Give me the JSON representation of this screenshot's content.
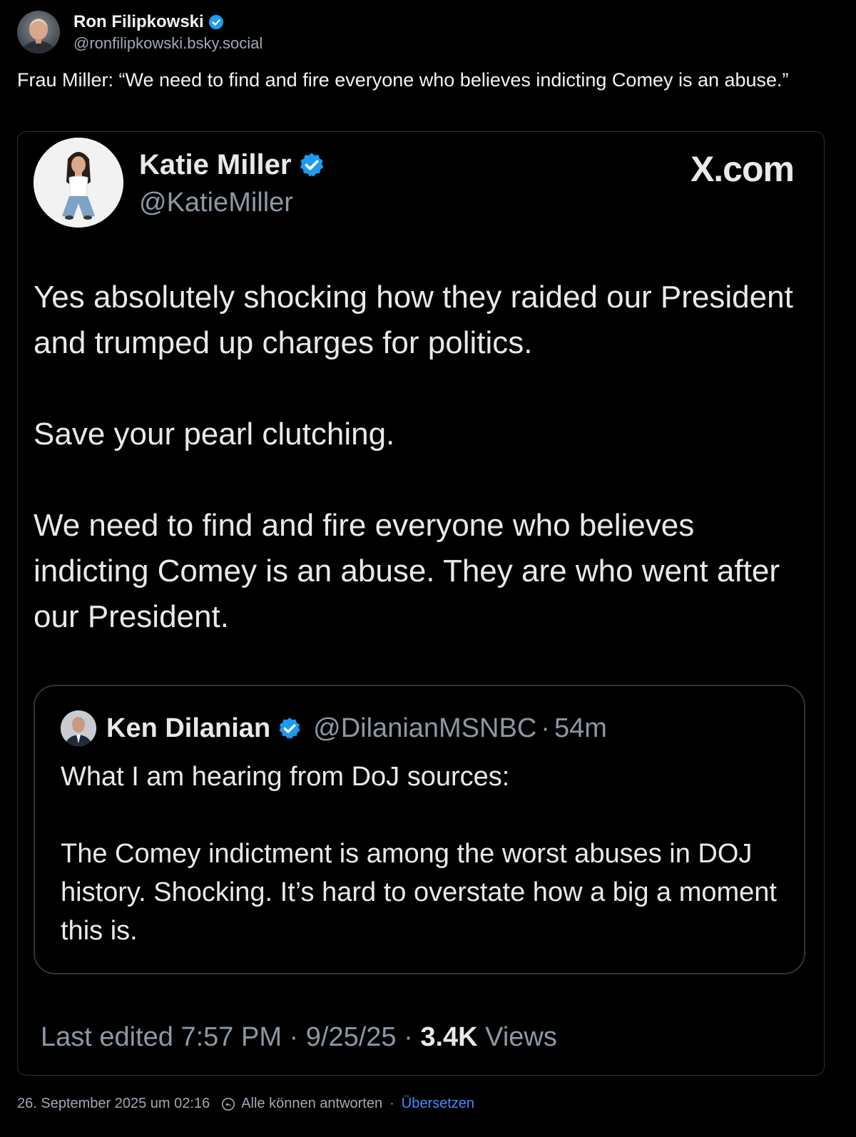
{
  "post": {
    "author": {
      "name": "Ron Filipkowski",
      "handle": "@ronfilipkowski.bsky.social",
      "verified": true
    },
    "text": "Frau Miller: “We need to find and fire everyone who believes indicting Comey is an abuse.”",
    "embedded_screenshot": {
      "brand": "X.com",
      "author": {
        "name": "Katie Miller",
        "handle": "@KatieMiller",
        "verified": true
      },
      "paragraphs": [
        "Yes absolutely shocking how they raided our President and trumped up charges for politics.",
        "Save your pearl clutching.",
        "We need to find and fire everyone who believes indicting Comey is an abuse. They are who went after our President."
      ],
      "quote": {
        "author_name": "Ken Dilanian",
        "handle": "@DilanianMSNBC",
        "separator": "·",
        "time": "54m",
        "paragraphs": [
          "What I am hearing from DoJ sources:",
          "The Comey indictment is among the worst abuses in DOJ history.  Shocking. It’s hard to overstate how a big a moment this is."
        ]
      },
      "meta": {
        "edited": "Last edited 7:57 PM · 9/25/25",
        "separator": " · ",
        "views_count": "3.4K",
        "views_label": " Views"
      }
    },
    "footer": {
      "timestamp": "26. September 2025 um 02:16",
      "reply_setting": "Alle können antworten",
      "separator": "·",
      "translate": "Übersetzen"
    }
  },
  "colors": {
    "background": "#000000",
    "text": "#f1f3f5",
    "muted": "#a0a8b6",
    "link": "#3f8cff",
    "verified": "#1d9bf0"
  },
  "icons": [
    "verified-badge-icon",
    "reply-settings-icon"
  ]
}
